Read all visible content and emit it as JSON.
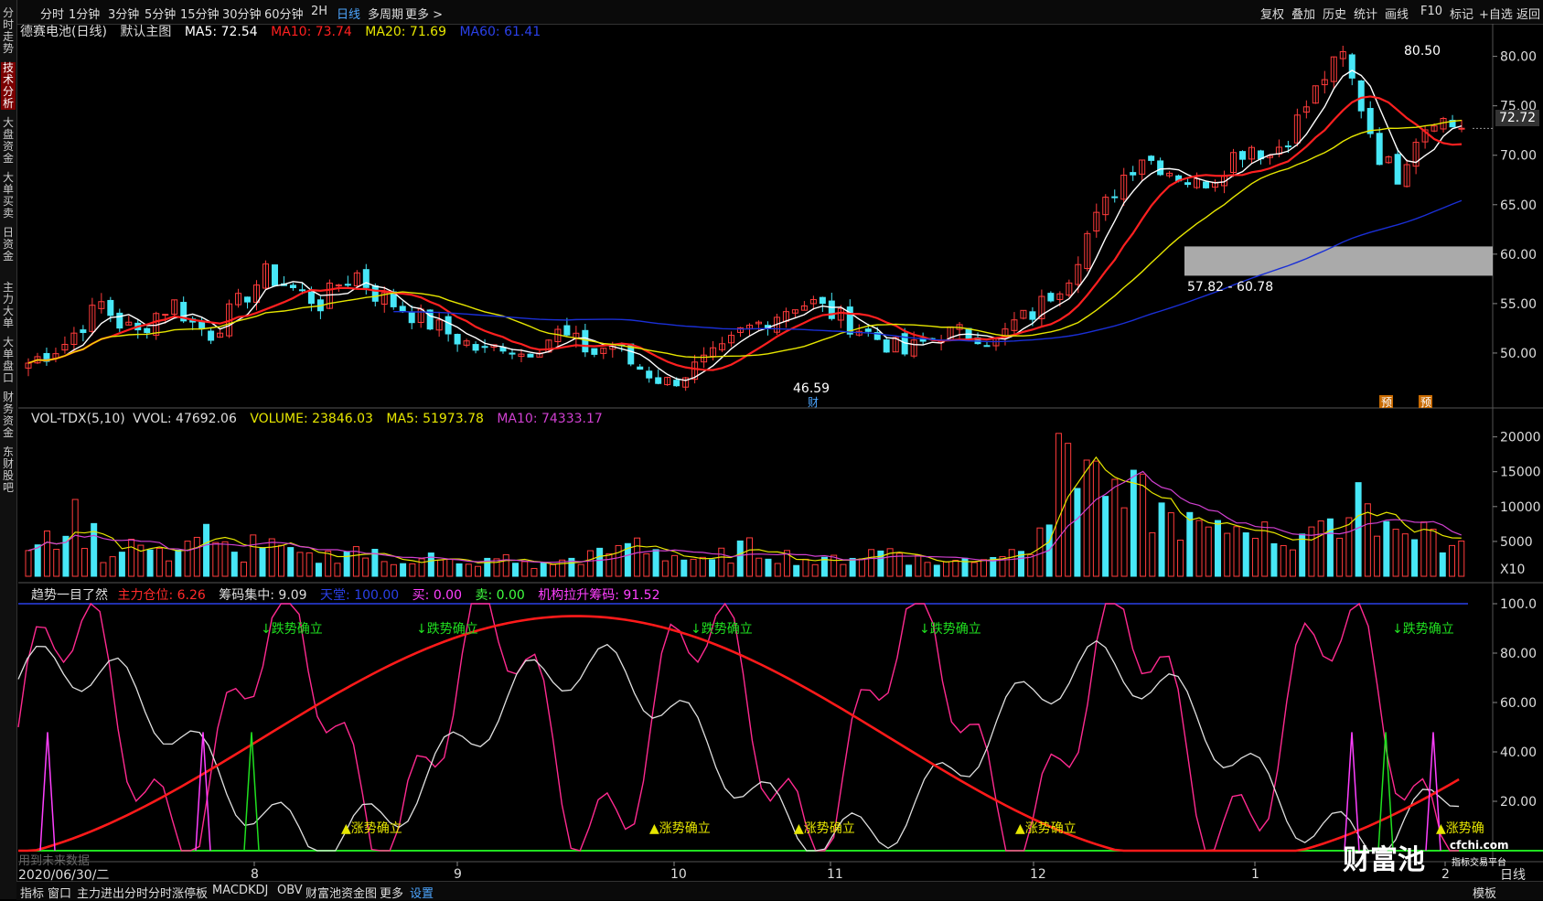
{
  "topbar": {
    "tabs": [
      "分时",
      "1分钟",
      "3分钟",
      "5分钟",
      "15分钟",
      "30分钟",
      "60分钟",
      "2H",
      "日线",
      "多周期",
      "更多 >"
    ],
    "active_tab": "日线",
    "right_buttons": [
      "复权",
      "叠加",
      "历史",
      "统计",
      "画线",
      "F10",
      "标记",
      "+自选",
      "返回"
    ]
  },
  "sidebar": {
    "items": [
      "分时走势",
      "技术分析",
      "大盘资金",
      "大单买卖",
      "日资金",
      "主力大单",
      "大单盘口",
      "财务资金",
      "东财股吧"
    ],
    "active": "技术分析"
  },
  "main_panel": {
    "stock": "德赛电池(日线)",
    "main_chart_label": "默认主图",
    "ma5": "MA5: 72.54",
    "ma10": "MA10: 73.74",
    "ma20": "MA20: 71.69",
    "ma60": "MA60: 61.41",
    "high_label": "80.50",
    "low_label": "46.59",
    "current_price": "72.72",
    "zone_label": "57.82 - 60.78",
    "event_marks": [
      "财",
      "预",
      "预"
    ],
    "colors": {
      "ma5": "#ffffff",
      "ma10": "#ff2020",
      "ma20": "#e6e600",
      "ma60": "#1a2fd6",
      "up": "#ff3b3b",
      "down": "#47e7f7"
    }
  },
  "volume_panel": {
    "title": "VOL-TDX(5,10)",
    "vvol": "VVOL: 47692.06",
    "volume": "VOLUME: 23846.03",
    "ma5": "MA5: 51973.78",
    "ma10": "MA10: 74333.17",
    "unit": "X10"
  },
  "trend_panel": {
    "title": "趋势一目了然",
    "main_pos": "主力仓位: 6.26",
    "chip_conc": "筹码集中: 9.09",
    "sky": "天堂: 100.00",
    "buy": "买: 0.00",
    "sell": "卖: 0.00",
    "inst": "机构拉升筹码: 91.52",
    "down_signal": "↓跌势确立",
    "up_signal": "▲涨势确立",
    "up_signal_cut": "▲涨势确",
    "watermark": "用到未来数据"
  },
  "x_axis": {
    "date_label": "2020/06/30/二",
    "month_ticks": [
      "8",
      "9",
      "10",
      "11",
      "12",
      "1",
      "2"
    ]
  },
  "right_footer": "日线",
  "bottombar": {
    "items": [
      "指标",
      "窗口",
      "主力进出分时",
      "分时涨停板",
      "MACD",
      "KDJ",
      "OBV",
      "财富池资金图",
      "更多",
      "设置"
    ],
    "template": "模板"
  },
  "branding": {
    "name": "财富池",
    "site": "cfchi.com",
    "slogan": "指标交易平台"
  },
  "chart_data": [
    {
      "type": "candlestick",
      "title": "德赛电池(日线)",
      "ylim": [
        45,
        82
      ],
      "y_ticks": [
        "80.00",
        "75.00",
        "70.00",
        "65.00",
        "60.00",
        "55.00",
        "50.00"
      ],
      "series": [
        {
          "name": "MA5",
          "last": 72.54
        },
        {
          "name": "MA10",
          "last": 73.74
        },
        {
          "name": "MA20",
          "last": 71.69
        },
        {
          "name": "MA60",
          "last": 61.41
        }
      ],
      "price_trace": [
        49,
        50,
        51,
        53,
        55,
        53,
        52,
        54,
        55,
        53,
        52,
        54,
        56,
        58,
        57,
        56,
        55,
        57,
        58,
        56,
        55,
        54,
        53,
        52,
        51,
        50,
        51,
        50,
        51,
        52,
        51,
        50,
        51,
        49,
        48,
        47,
        48,
        49,
        50,
        52,
        53,
        54,
        55,
        55,
        54,
        53,
        52,
        51,
        50,
        51,
        52,
        52,
        52,
        51,
        53,
        54,
        56,
        58,
        62,
        65,
        68,
        70,
        69,
        68,
        67,
        68,
        70,
        71,
        70,
        72,
        75,
        78,
        80,
        75,
        70,
        68,
        72,
        74,
        73
      ],
      "close_annotations": {
        "high": 80.5,
        "low": 46.59,
        "last": 72.72
      },
      "zone": [
        57.82,
        60.78
      ]
    },
    {
      "type": "bar",
      "title": "VOL-TDX(5,10)",
      "ylim": [
        0,
        21000
      ],
      "y_ticks": [
        "20000",
        "15000",
        "10000",
        "5000"
      ],
      "values_trace": [
        4000,
        5000,
        8000,
        6000,
        3000,
        5000,
        4000,
        3000,
        5000,
        6000,
        4000,
        3000,
        5000,
        4000,
        3000,
        2500,
        3000,
        4000,
        3000,
        2000,
        2500,
        3000,
        2000,
        1500,
        2000,
        2500,
        2000,
        1500,
        2000,
        2500,
        3000,
        3500,
        5000,
        4000,
        3000,
        2500,
        2000,
        3000,
        4000,
        3500,
        3000,
        2500,
        2000,
        2500,
        3000,
        3500,
        4000,
        2500,
        2000,
        2000,
        2500,
        3000,
        3500,
        5000,
        9000,
        20000,
        17000,
        14000,
        10000,
        11000,
        9000,
        8000,
        7000,
        6000,
        7000,
        8000,
        6000,
        5000,
        7000,
        6000,
        9000,
        13000,
        8000,
        6000,
        7000,
        5000,
        4000
      ]
    },
    {
      "type": "line",
      "title": "趋势一目了然",
      "ylim": [
        0,
        100
      ],
      "y_ticks": [
        "100.0",
        "80.00",
        "60.00",
        "40.00",
        "20.00"
      ]
    }
  ]
}
